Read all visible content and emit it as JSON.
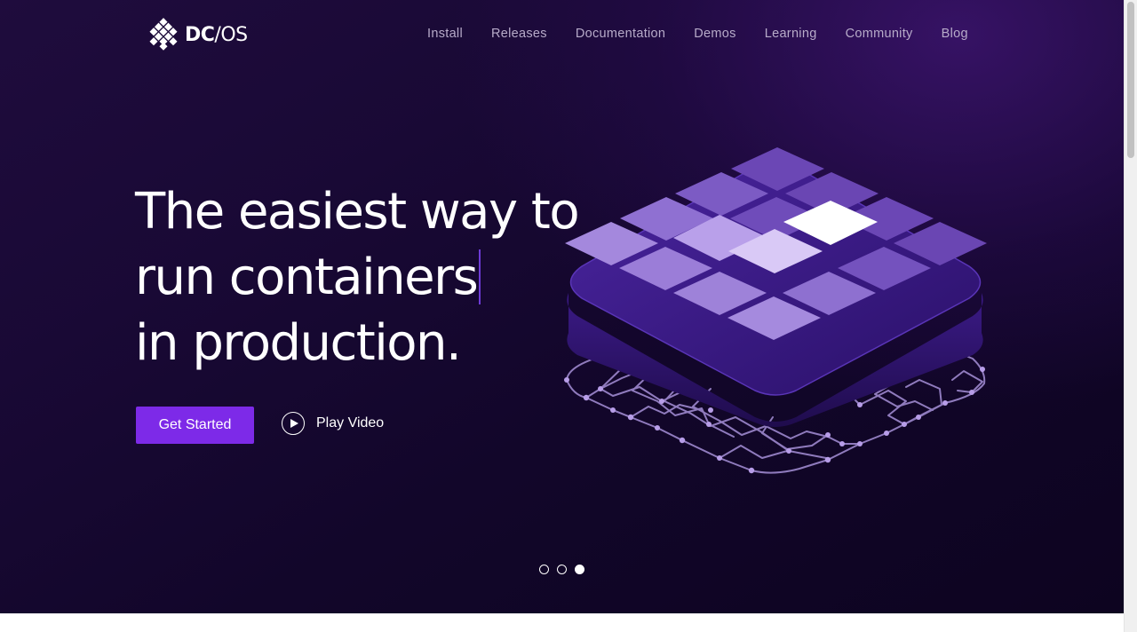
{
  "brand": {
    "bold": "DC",
    "light": "/OS"
  },
  "nav": {
    "items": [
      {
        "key": "install",
        "label": "Install"
      },
      {
        "key": "releases",
        "label": "Releases"
      },
      {
        "key": "documentation",
        "label": "Documentation"
      },
      {
        "key": "demos",
        "label": "Demos"
      },
      {
        "key": "learning",
        "label": "Learning"
      },
      {
        "key": "community",
        "label": "Community"
      },
      {
        "key": "blog",
        "label": "Blog"
      }
    ]
  },
  "hero": {
    "headline": [
      "The easiest way to",
      "run containers",
      "in production."
    ],
    "primary_cta": "Get Started",
    "video_cta": "Play Video"
  },
  "carousel": {
    "slides": 3,
    "active_index": 3
  },
  "colors": {
    "background": "#160832",
    "accent": "#7d2ae8",
    "nav_text": "#b7abc9",
    "tile_light": "#b89fe6",
    "tile_dark": "#6b47b5"
  },
  "icons": [
    "dcos-logo-icon",
    "play-circle-icon"
  ]
}
